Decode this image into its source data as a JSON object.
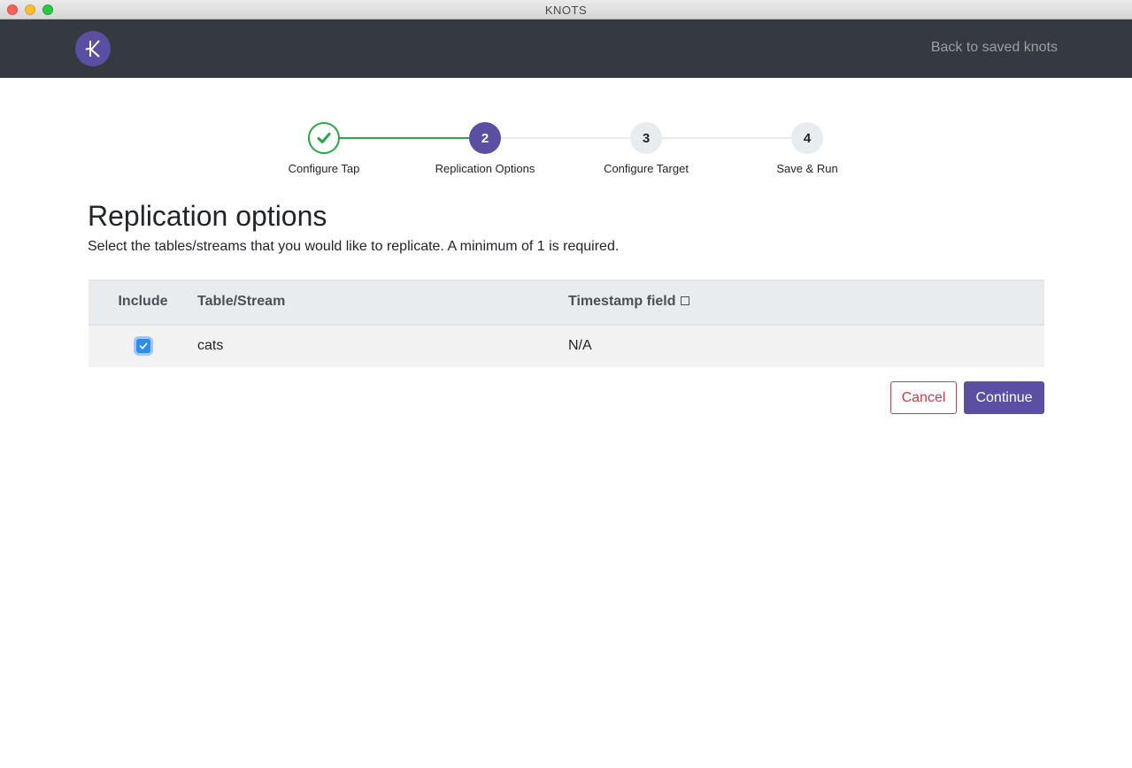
{
  "window": {
    "title": "KNOTS"
  },
  "navbar": {
    "back_link": "Back to saved knots"
  },
  "stepper": {
    "steps": [
      {
        "number": "1",
        "label": "Configure Tap",
        "state": "completed"
      },
      {
        "number": "2",
        "label": "Replication Options",
        "state": "active"
      },
      {
        "number": "3",
        "label": "Configure Target",
        "state": "pending"
      },
      {
        "number": "4",
        "label": "Save & Run",
        "state": "pending"
      }
    ]
  },
  "page": {
    "title": "Replication options",
    "subtitle": "Select the tables/streams that you would like to replicate. A minimum of 1 is required."
  },
  "table": {
    "headers": {
      "include": "Include",
      "stream": "Table/Stream",
      "timestamp": "Timestamp field"
    },
    "rows": [
      {
        "include": true,
        "stream": "cats",
        "timestamp": "N/A"
      }
    ]
  },
  "actions": {
    "cancel": "Cancel",
    "continue": "Continue"
  },
  "colors": {
    "brand": "#5b4fa3",
    "success": "#28a745",
    "danger": "#dc3545",
    "navbar": "#343a40"
  }
}
